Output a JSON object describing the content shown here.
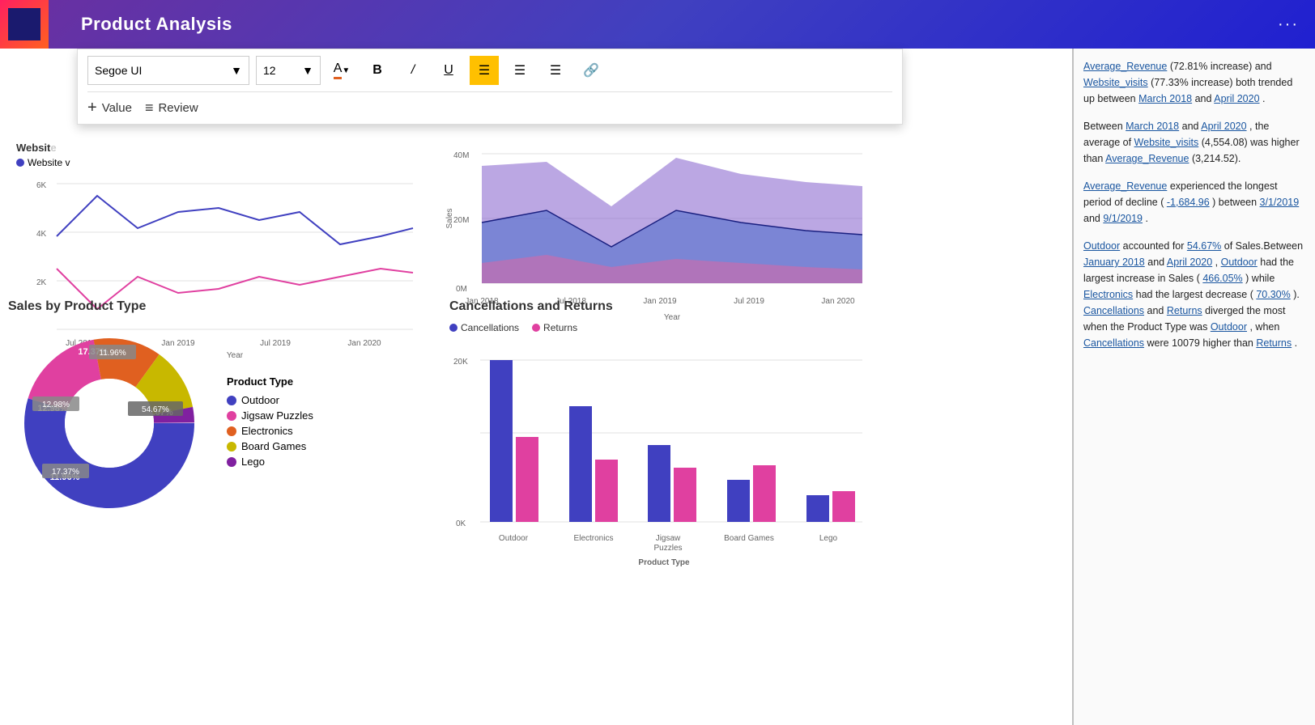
{
  "header": {
    "title": "Product Analysis",
    "dots": "···"
  },
  "toolbar": {
    "font_name": "Segoe UI",
    "font_size": "12",
    "value_label": "Value",
    "review_label": "Review",
    "font_color_icon": "A",
    "bold_label": "B",
    "italic_label": "/",
    "underline_label": "U",
    "align_left_label": "≡",
    "align_center_label": "≡",
    "align_right_label": "≡",
    "link_label": "🔗"
  },
  "website_chart": {
    "label": "Website v...",
    "legend": "Website v",
    "y_labels": [
      "6K",
      "4K",
      "2K"
    ],
    "x_labels": [
      "Jul 2018",
      "Jan 2019",
      "Jul 2019",
      "Jan 2020"
    ],
    "x_axis_label": "Year"
  },
  "sales_chart": {
    "y_labels": [
      "40M",
      "20M",
      "0M"
    ],
    "x_labels": [
      "Jan 2018",
      "Jul 2018",
      "Jan 2019",
      "Jul 2019",
      "Jan 2020"
    ],
    "x_axis_label": "Year",
    "sales_label": "Sales"
  },
  "donut_section": {
    "title": "Sales by Product Type",
    "segments": [
      {
        "label": "Outdoor",
        "color": "#4040c0",
        "pct": 54.67,
        "pct_label": "54.67%"
      },
      {
        "label": "Jigsaw Puzzles",
        "color": "#e040a0",
        "pct": 17.37,
        "pct_label": "17.37%"
      },
      {
        "label": "Electronics",
        "color": "#e06020",
        "pct": 12.98,
        "pct_label": "12.98%"
      },
      {
        "label": "Board Games",
        "color": "#d0c000",
        "pct": 11.96,
        "pct_label": "11.96%"
      },
      {
        "label": "Lego",
        "color": "#8020a0",
        "pct": 2.96,
        "pct_label": ""
      }
    ]
  },
  "cancel_section": {
    "title": "Cancellations and Returns",
    "legend_cancellations": "Cancellations",
    "legend_returns": "Returns",
    "x_axis_label": "Product Type",
    "y_labels": [
      "20K",
      "0K"
    ],
    "categories": [
      "Outdoor",
      "Electronics",
      "Jigsaw\nPuzzles",
      "Board Games",
      "Lego"
    ],
    "cancellations": [
      21000,
      15000,
      10000,
      5500,
      3500
    ],
    "returns": [
      11000,
      8000,
      7000,
      7500,
      4000
    ]
  },
  "right_panel": {
    "para1_text": " (72.81% increase) and ",
    "para1_rev": "Average_Revenue",
    "para1_visits": "Website_visits",
    "para1_visits2": "(77.33% increase)",
    "para1_rest": " both trended up between ",
    "para1_march": "March 2018",
    "para1_and": " and ",
    "para1_april": "April 2020",
    "para1_end": ".",
    "para2": "Between March 2018 and April 2020, the average of Website_visits (4,554.08) was higher than Average_Revenue (3,214.52).",
    "para3": "Average_Revenue experienced the longest period of decline (-1,684.96) between 3/1/2019 and 9/1/2019.",
    "para4": "Outdoor accounted for 54.67% of Sales.Between January 2018 and April 2020, Outdoor had the largest increase in Sales (466.05%) while Electronics had the largest decrease (70.30%). Cancellations and Returns diverged the most when the Product Type was Outdoor, when Cancellations were 10079 higher than Returns."
  }
}
